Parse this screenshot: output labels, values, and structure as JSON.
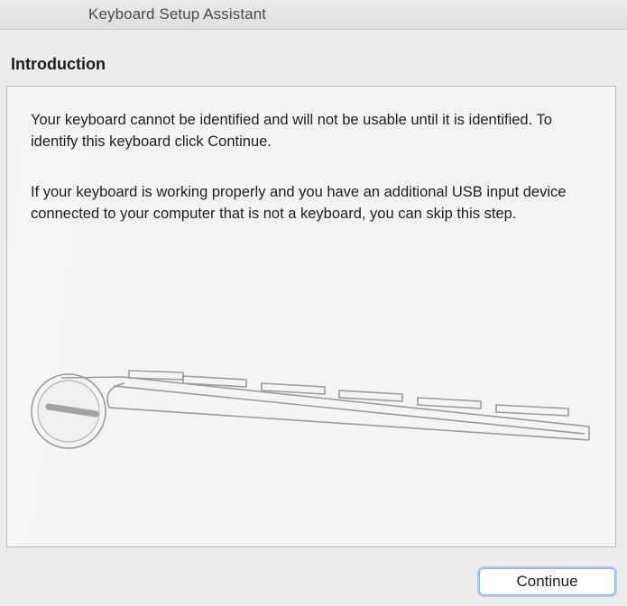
{
  "window": {
    "title": "Keyboard Setup Assistant"
  },
  "section": {
    "title": "Introduction"
  },
  "content": {
    "paragraph_1": "Your keyboard cannot be identified and will not be usable until it is identified. To identify this keyboard click Continue.",
    "paragraph_2": "If your keyboard is working properly and you have an additional USB input device connected to your computer that is not a keyboard, you can skip this step.",
    "illustration": "keyboard-outline-icon"
  },
  "buttons": {
    "continue_label": "Continue"
  },
  "colors": {
    "window_background": "#ececec",
    "content_background": "#f4f4f4",
    "focus_ring": "#aecbf3"
  }
}
